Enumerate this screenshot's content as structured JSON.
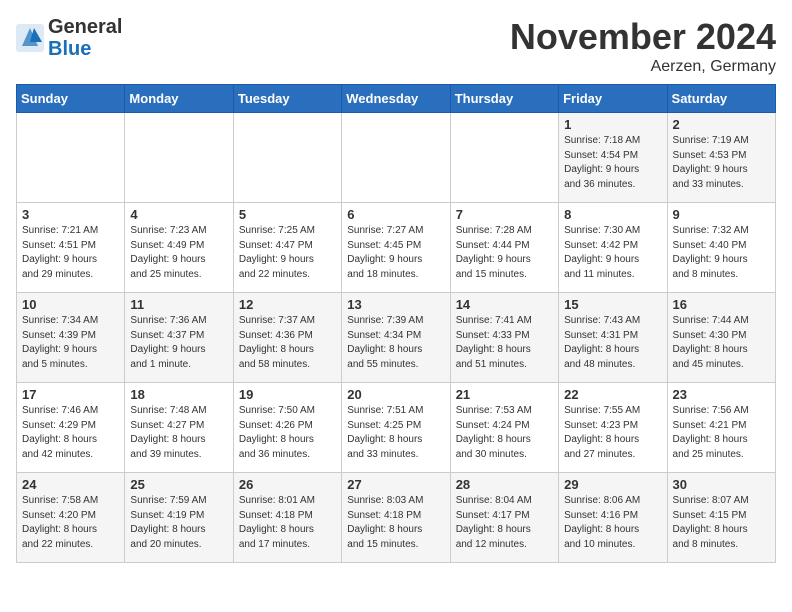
{
  "header": {
    "logo": {
      "general": "General",
      "blue": "Blue"
    },
    "title": "November 2024",
    "location": "Aerzen, Germany"
  },
  "days_of_week": [
    "Sunday",
    "Monday",
    "Tuesday",
    "Wednesday",
    "Thursday",
    "Friday",
    "Saturday"
  ],
  "weeks": [
    {
      "days": [
        {
          "number": "",
          "info": ""
        },
        {
          "number": "",
          "info": ""
        },
        {
          "number": "",
          "info": ""
        },
        {
          "number": "",
          "info": ""
        },
        {
          "number": "",
          "info": ""
        },
        {
          "number": "1",
          "info": "Sunrise: 7:18 AM\nSunset: 4:54 PM\nDaylight: 9 hours\nand 36 minutes."
        },
        {
          "number": "2",
          "info": "Sunrise: 7:19 AM\nSunset: 4:53 PM\nDaylight: 9 hours\nand 33 minutes."
        }
      ]
    },
    {
      "days": [
        {
          "number": "3",
          "info": "Sunrise: 7:21 AM\nSunset: 4:51 PM\nDaylight: 9 hours\nand 29 minutes."
        },
        {
          "number": "4",
          "info": "Sunrise: 7:23 AM\nSunset: 4:49 PM\nDaylight: 9 hours\nand 25 minutes."
        },
        {
          "number": "5",
          "info": "Sunrise: 7:25 AM\nSunset: 4:47 PM\nDaylight: 9 hours\nand 22 minutes."
        },
        {
          "number": "6",
          "info": "Sunrise: 7:27 AM\nSunset: 4:45 PM\nDaylight: 9 hours\nand 18 minutes."
        },
        {
          "number": "7",
          "info": "Sunrise: 7:28 AM\nSunset: 4:44 PM\nDaylight: 9 hours\nand 15 minutes."
        },
        {
          "number": "8",
          "info": "Sunrise: 7:30 AM\nSunset: 4:42 PM\nDaylight: 9 hours\nand 11 minutes."
        },
        {
          "number": "9",
          "info": "Sunrise: 7:32 AM\nSunset: 4:40 PM\nDaylight: 9 hours\nand 8 minutes."
        }
      ]
    },
    {
      "days": [
        {
          "number": "10",
          "info": "Sunrise: 7:34 AM\nSunset: 4:39 PM\nDaylight: 9 hours\nand 5 minutes."
        },
        {
          "number": "11",
          "info": "Sunrise: 7:36 AM\nSunset: 4:37 PM\nDaylight: 9 hours\nand 1 minute."
        },
        {
          "number": "12",
          "info": "Sunrise: 7:37 AM\nSunset: 4:36 PM\nDaylight: 8 hours\nand 58 minutes."
        },
        {
          "number": "13",
          "info": "Sunrise: 7:39 AM\nSunset: 4:34 PM\nDaylight: 8 hours\nand 55 minutes."
        },
        {
          "number": "14",
          "info": "Sunrise: 7:41 AM\nSunset: 4:33 PM\nDaylight: 8 hours\nand 51 minutes."
        },
        {
          "number": "15",
          "info": "Sunrise: 7:43 AM\nSunset: 4:31 PM\nDaylight: 8 hours\nand 48 minutes."
        },
        {
          "number": "16",
          "info": "Sunrise: 7:44 AM\nSunset: 4:30 PM\nDaylight: 8 hours\nand 45 minutes."
        }
      ]
    },
    {
      "days": [
        {
          "number": "17",
          "info": "Sunrise: 7:46 AM\nSunset: 4:29 PM\nDaylight: 8 hours\nand 42 minutes."
        },
        {
          "number": "18",
          "info": "Sunrise: 7:48 AM\nSunset: 4:27 PM\nDaylight: 8 hours\nand 39 minutes."
        },
        {
          "number": "19",
          "info": "Sunrise: 7:50 AM\nSunset: 4:26 PM\nDaylight: 8 hours\nand 36 minutes."
        },
        {
          "number": "20",
          "info": "Sunrise: 7:51 AM\nSunset: 4:25 PM\nDaylight: 8 hours\nand 33 minutes."
        },
        {
          "number": "21",
          "info": "Sunrise: 7:53 AM\nSunset: 4:24 PM\nDaylight: 8 hours\nand 30 minutes."
        },
        {
          "number": "22",
          "info": "Sunrise: 7:55 AM\nSunset: 4:23 PM\nDaylight: 8 hours\nand 27 minutes."
        },
        {
          "number": "23",
          "info": "Sunrise: 7:56 AM\nSunset: 4:21 PM\nDaylight: 8 hours\nand 25 minutes."
        }
      ]
    },
    {
      "days": [
        {
          "number": "24",
          "info": "Sunrise: 7:58 AM\nSunset: 4:20 PM\nDaylight: 8 hours\nand 22 minutes."
        },
        {
          "number": "25",
          "info": "Sunrise: 7:59 AM\nSunset: 4:19 PM\nDaylight: 8 hours\nand 20 minutes."
        },
        {
          "number": "26",
          "info": "Sunrise: 8:01 AM\nSunset: 4:18 PM\nDaylight: 8 hours\nand 17 minutes."
        },
        {
          "number": "27",
          "info": "Sunrise: 8:03 AM\nSunset: 4:18 PM\nDaylight: 8 hours\nand 15 minutes."
        },
        {
          "number": "28",
          "info": "Sunrise: 8:04 AM\nSunset: 4:17 PM\nDaylight: 8 hours\nand 12 minutes."
        },
        {
          "number": "29",
          "info": "Sunrise: 8:06 AM\nSunset: 4:16 PM\nDaylight: 8 hours\nand 10 minutes."
        },
        {
          "number": "30",
          "info": "Sunrise: 8:07 AM\nSunset: 4:15 PM\nDaylight: 8 hours\nand 8 minutes."
        }
      ]
    }
  ]
}
